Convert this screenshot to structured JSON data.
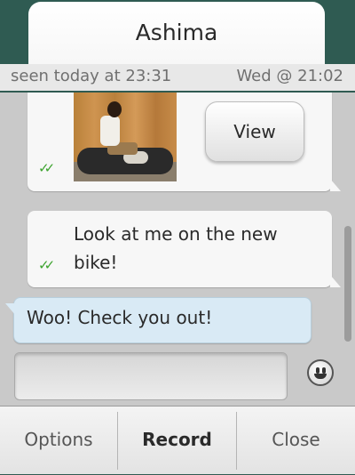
{
  "header": {
    "contact_name": "Ashima",
    "last_seen": "seen today at 23:31",
    "date_marker": "Wed @ 21:02"
  },
  "messages": [
    {
      "direction": "outgoing",
      "type": "photo",
      "action_label": "View",
      "status": "read"
    },
    {
      "direction": "outgoing",
      "type": "text",
      "text": "Look at me on the new bike!",
      "status": "read"
    },
    {
      "direction": "incoming",
      "type": "text",
      "text": "Woo! Check you out!"
    }
  ],
  "compose": {
    "value": "",
    "emoji_icon": "smiley-icon"
  },
  "toolbar": {
    "options_label": "Options",
    "record_label": "Record",
    "close_label": "Close"
  },
  "colors": {
    "frame": "#2f5b52",
    "read_tick": "#3ca32e",
    "incoming_bubble": "#d9eaf5"
  }
}
